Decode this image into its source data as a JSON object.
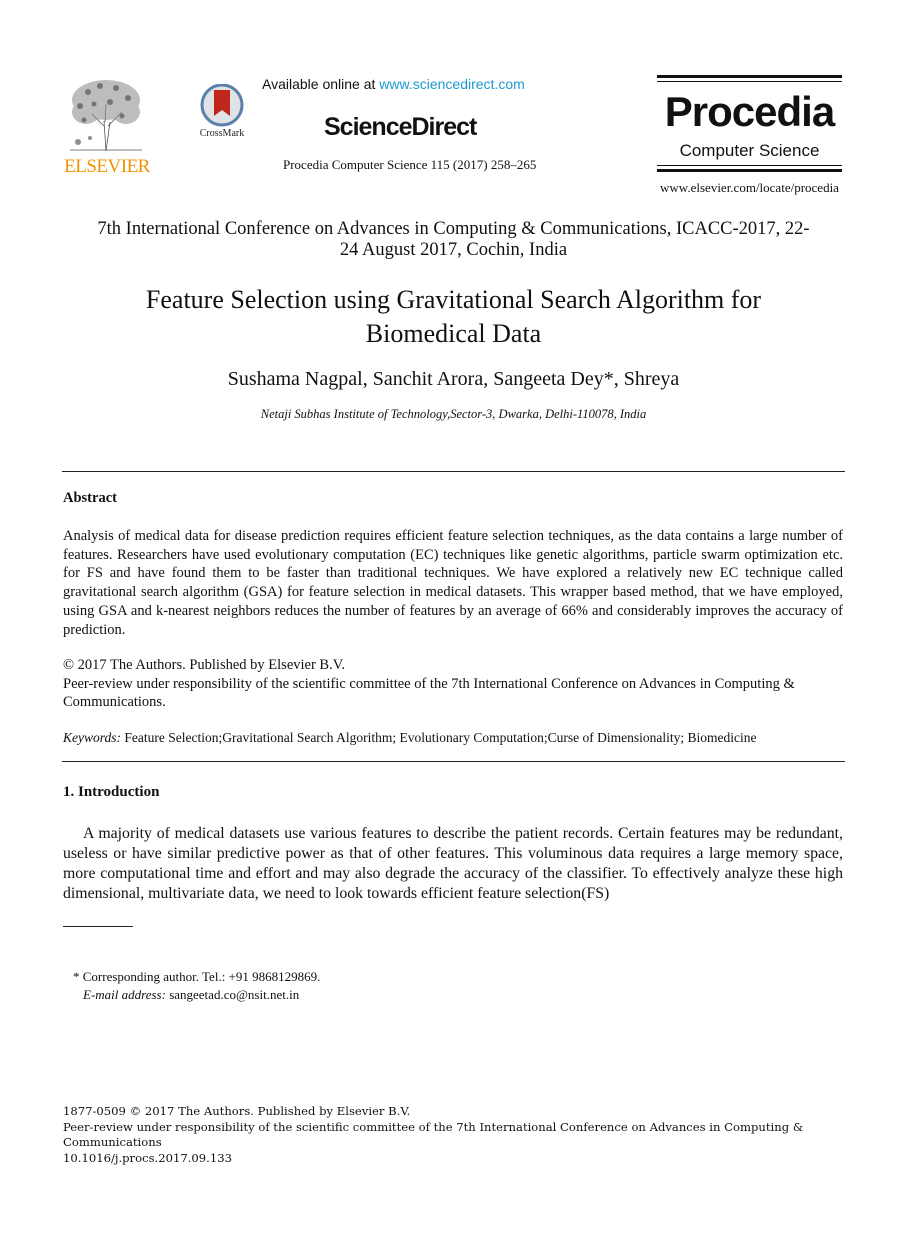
{
  "header": {
    "publisher_logo_text": "ELSEVIER",
    "crossmark_label": "CrossMark",
    "available_online_prefix": "Available online at ",
    "available_online_link": "www.sciencedirect.com",
    "sciencedirect_logo": "ScienceDirect",
    "journal_reference": "Procedia Computer Science 115 (2017) 258–265",
    "journal_logo_title": "Procedia",
    "journal_logo_subtitle": "Computer Science",
    "journal_url": "www.elsevier.com/locate/procedia",
    "colors": {
      "elsevier_orange": "#f39200",
      "link_blue": "#1a9bd0",
      "crossmark_red": "#c0261b"
    }
  },
  "paper": {
    "conference_line1": "7th International Conference on Advances in Computing & Communications, ICACC-2017, 22-",
    "conference_line2": "24 August 2017, Cochin, India",
    "title_line1": "Feature Selection using Gravitational Search Algorithm for",
    "title_line2": "Biomedical Data",
    "authors": "Sushama Nagpal, Sanchit Arora, Sangeeta Dey*, Shreya",
    "affiliation": "Netaji Subhas Institute of Technology,Sector-3, Dwarka, Delhi-110078, India"
  },
  "abstract": {
    "heading": "Abstract",
    "text": "Analysis of medical data for disease prediction requires efficient feature selection techniques, as the data contains a large number of features. Researchers have used evolutionary computation (EC) techniques like genetic algorithms, particle swarm optimization etc. for FS and have found them to be faster than traditional techniques. We have explored a relatively new EC technique called gravitational search algorithm (GSA) for feature selection in medical datasets. This wrapper based method, that we have employed, using GSA and k-nearest neighbors reduces the number of features by an average of 66% and considerably improves the accuracy of prediction.",
    "copyright": "© 2017 The Authors. Published by Elsevier B.V.",
    "peer_review": "Peer-review under responsibility of the scientific committee of the 7th International Conference on Advances in Computing & Communications.",
    "keywords_label": "Keywords:",
    "keywords": "Feature Selection;Gravitational Search Algorithm; Evolutionary Computation;Curse of Dimensionality; Biomedicine"
  },
  "introduction": {
    "heading": "1. Introduction",
    "text": "A majority of medical datasets use various features to describe the patient records. Certain features may be redundant, useless or have similar predictive power as that of other features. This voluminous data requires a large memory space, more computational time and effort and may also degrade the accuracy of the classifier. To effectively analyze these high dimensional, multivariate data, we need to look towards efficient feature selection(FS)"
  },
  "footnote": {
    "corresponding": "* Corresponding author. Tel.: +91 9868129869.",
    "email_label": "E-mail address:",
    "email": "sangeetad.co@nsit.net.in"
  },
  "footer": {
    "issn_line": "1877-0509 © 2017 The Authors. Published by Elsevier B.V.",
    "peer_review": "Peer-review under responsibility of the scientific committee of the 7th International Conference on Advances in Computing & Communications",
    "doi": "10.1016/j.procs.2017.09.133"
  }
}
